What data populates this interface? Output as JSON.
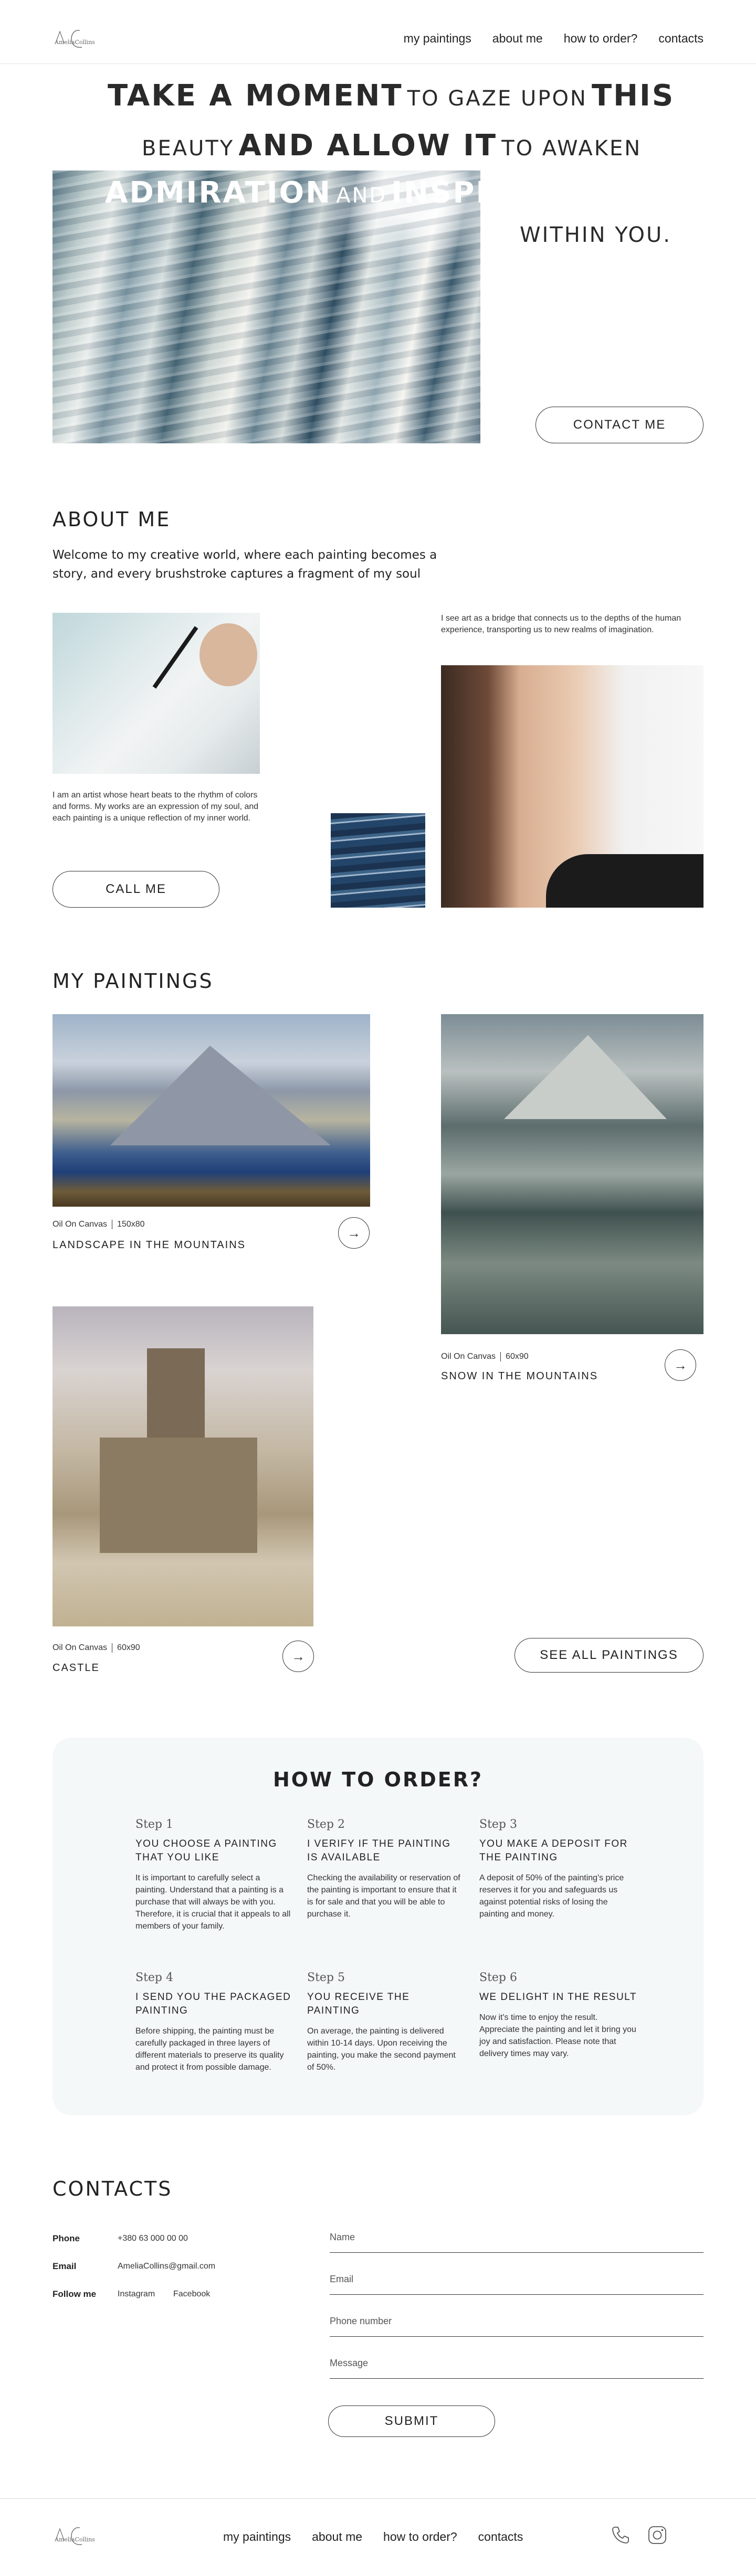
{
  "header": {
    "logo_text": "AmeliaCollins",
    "nav": [
      {
        "label": "my paintings"
      },
      {
        "label": "about me"
      },
      {
        "label": "how to order?"
      },
      {
        "label": "contacts"
      }
    ]
  },
  "hero": {
    "line1_a": "Take a moment",
    "line1_b": "to gaze upon",
    "line1_c": "this",
    "line2_a": "beauty",
    "line2_b": "and allow it",
    "line2_c": "to awaken",
    "line3_a": "admiration",
    "line3_b": "and",
    "line3_c": "inspiration",
    "line4": "within you.",
    "button": "CONTACT ME"
  },
  "about": {
    "title": "ABOUT ME",
    "intro": "Welcome to my creative world, where each painting becomes a story, and every brushstroke captures a fragment of my soul",
    "text1": "I am an artist whose heart beats to the rhythm of colors and forms. My works are an expression of my soul, and each painting is a unique reflection of my inner world.",
    "text2": "I see art as a bridge that connects us to the depths of the human experience, transporting us to new realms of imagination.",
    "button": "CALL ME"
  },
  "paintings": {
    "title": "MY PAINTINGS",
    "items": [
      {
        "technique": "Oil On Canvas",
        "size": "150x80",
        "name": "LANDSCAPE IN THE MOUNTAINS"
      },
      {
        "technique": "Oil On Canvas",
        "size": "60x90",
        "name": "SNOW IN THE MOUNTAINS"
      },
      {
        "technique": "Oil On Canvas",
        "size": "60x90",
        "name": "CASTLE"
      }
    ],
    "arrow": "→",
    "see_all": "SEE ALL PAINTINGS"
  },
  "order": {
    "title": "HOW TO ORDER?",
    "steps": [
      {
        "no": "Step 1",
        "title": "YOU CHOOSE A PAINTING THAT YOU LIKE",
        "text": "It is important to carefully select a painting. Understand that a painting is a purchase that will always be with you. Therefore, it is crucial that it appeals to all members of your family."
      },
      {
        "no": "Step 2",
        "title": "I VERIFY IF THE PAINTING IS AVAILABLE",
        "text": "Checking the availability or reservation of the painting is important to ensure that it is for sale and that you will be able to purchase it."
      },
      {
        "no": "Step 3",
        "title": "YOU MAKE A DEPOSIT FOR THE PAINTING",
        "text": "A deposit of 50% of the painting's price reserves it for you and safeguards us against potential risks of losing the painting and money."
      },
      {
        "no": "Step 4",
        "title": "I SEND YOU THE PACKAGED PAINTING",
        "text": "Before shipping, the painting must be carefully packaged in three layers of different materials to preserve its quality and protect it from possible damage."
      },
      {
        "no": "Step 5",
        "title": "YOU RECEIVE THE PAINTING",
        "text": "On average, the painting is delivered within 10-14 days. Upon receiving the painting, you make the second payment of 50%."
      },
      {
        "no": "Step 6",
        "title": "WE DELIGHT IN THE RESULT",
        "text": "Now it's time to enjoy the result. Appreciate the painting and let it bring you joy and satisfaction. Please note that delivery times may vary."
      }
    ]
  },
  "contacts": {
    "title": "CONTACTS",
    "phone_label": "Phone",
    "phone": "+380 63 000 00 00",
    "email_label": "Email",
    "email": "AmeliaCollins@gmail.com",
    "follow_label": "Follow me",
    "instagram": "Instagram",
    "facebook": "Facebook",
    "form": {
      "name": "Name",
      "email": "Email",
      "phone": "Phone number",
      "message": "Message",
      "submit": "SUBMIT"
    }
  },
  "footer": {
    "logo_text": "AmeliaCollins",
    "nav": [
      {
        "label": "my paintings"
      },
      {
        "label": "about me"
      },
      {
        "label": "how to order?"
      },
      {
        "label": "contacts"
      }
    ],
    "icons": [
      "phone-icon",
      "instagram-icon"
    ]
  }
}
